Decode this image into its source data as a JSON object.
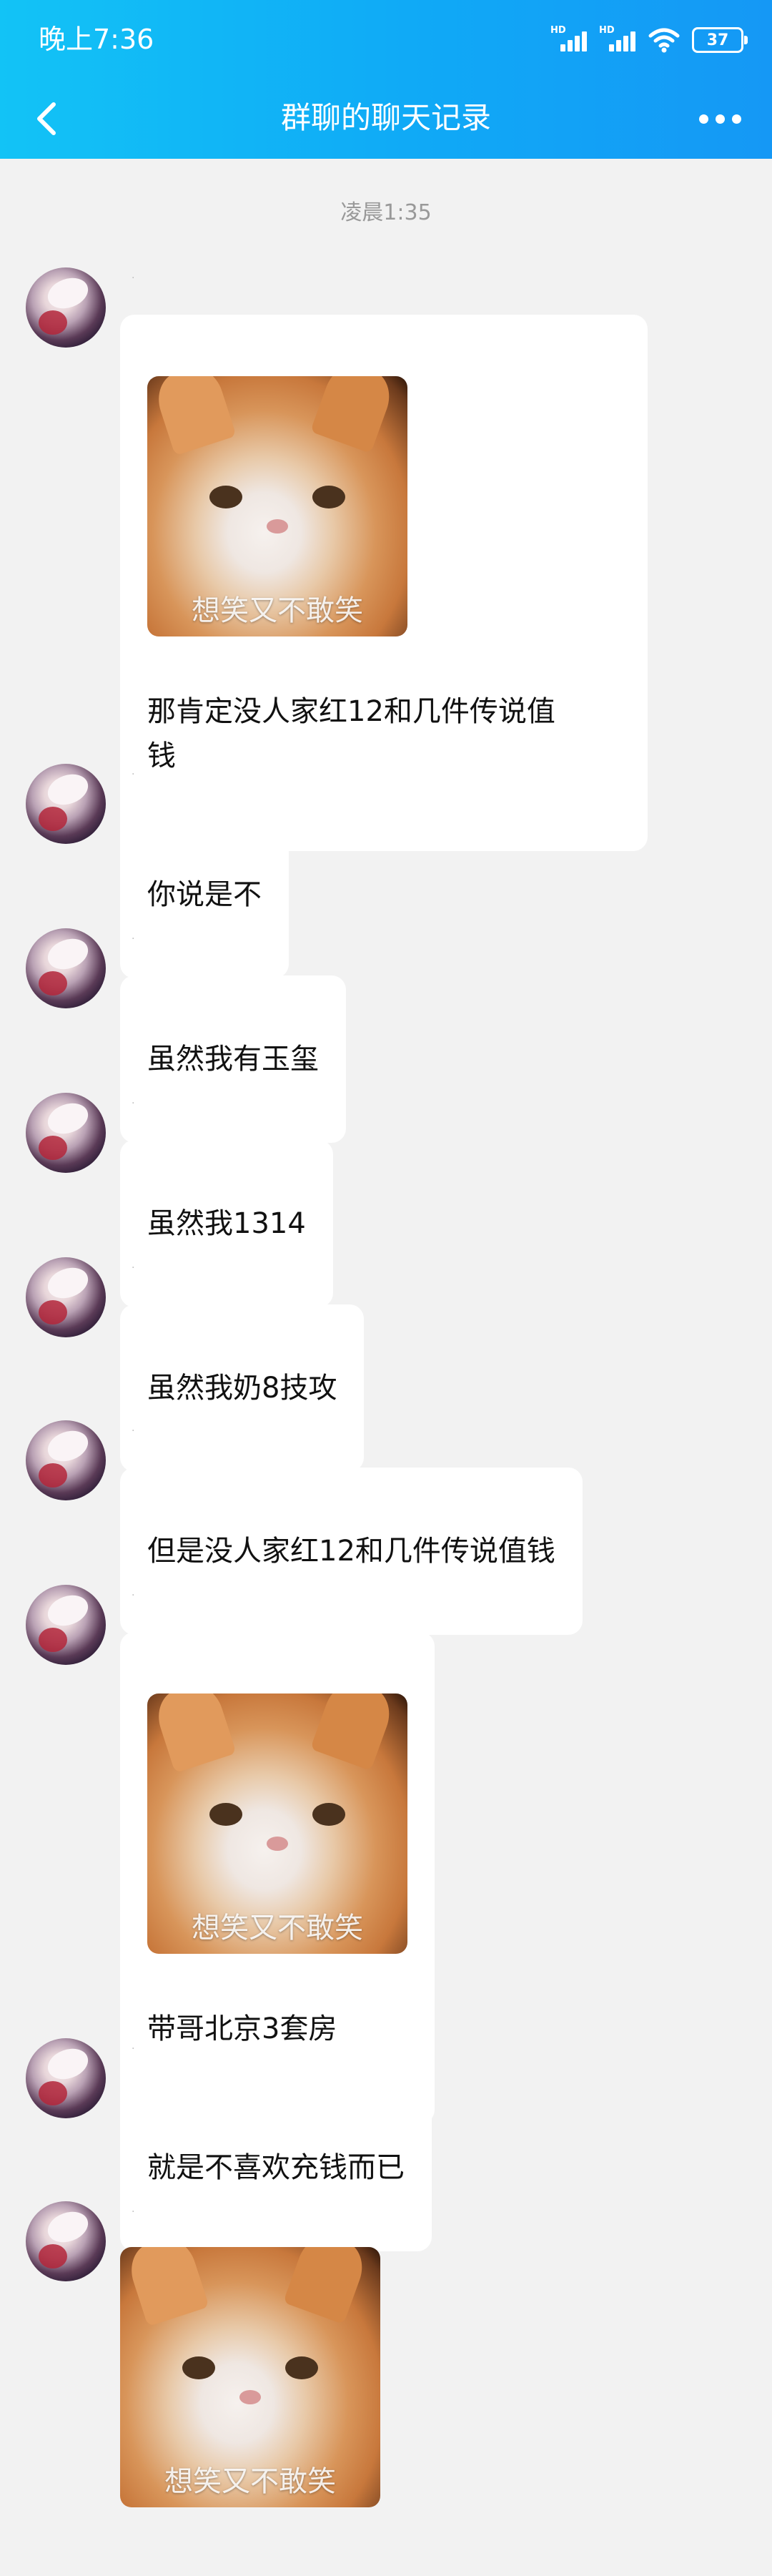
{
  "status_bar": {
    "time": "晚上7:36",
    "network_label": "HD",
    "battery": "37"
  },
  "nav": {
    "title": "群聊的聊天记录"
  },
  "timestamp": "凌晨1:35",
  "sticker_caption": "想笑又不敢笑",
  "icons": {
    "back": "chevron-left-icon",
    "more": "more-dots-icon",
    "wifi": "wifi-icon",
    "signal": "signal-icon",
    "battery": "battery-icon"
  },
  "messages": [
    {
      "type": "sticker+text",
      "text": "那肯定没人家红12和几件传说值\n钱"
    },
    {
      "type": "text",
      "text": "你说是不"
    },
    {
      "type": "text",
      "text": "虽然我有玉玺"
    },
    {
      "type": "text",
      "text": "虽然我1314"
    },
    {
      "type": "text",
      "text": "虽然我奶8技攻"
    },
    {
      "type": "text",
      "text": "但是没人家红12和几件传说值钱"
    },
    {
      "type": "sticker+text",
      "text": "带哥北京3套房"
    },
    {
      "type": "text",
      "text": "就是不喜欢充钱而已"
    },
    {
      "type": "sticker"
    }
  ],
  "colors": {
    "header_start": "#12c3f6",
    "header_end": "#1598f5",
    "background": "#f2f2f2",
    "bubble": "#ffffff"
  }
}
